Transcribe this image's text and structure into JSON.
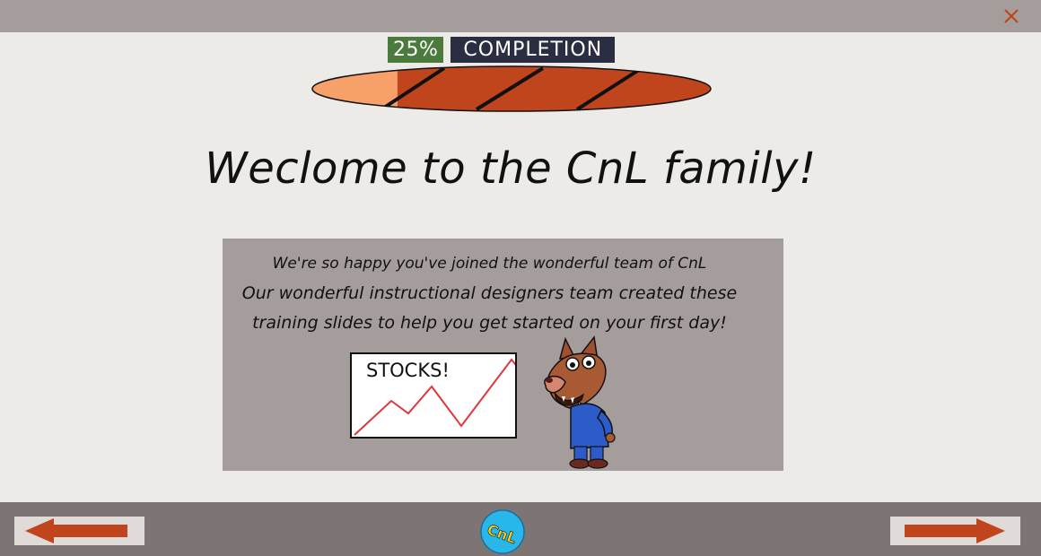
{
  "progress": {
    "percent_label": "25%",
    "completion_label": "COMPLETION",
    "value": 0.25,
    "fill_color": "#f7a06a",
    "track_color": "#c0451c"
  },
  "header": {
    "close_icon": "close-icon"
  },
  "main": {
    "title": "Weclome to the CnL family!",
    "panel": {
      "line1": "We're so happy you've joined the wonderful team of CnL",
      "line2": "Our wonderful instructional designers team created these",
      "line3": "training slides to help you get started on your first day!",
      "board_label": "STOCKS!"
    }
  },
  "footer": {
    "prev_icon": "arrow-left-icon",
    "next_icon": "arrow-right-icon",
    "logo_text": "CnL"
  },
  "colors": {
    "accent": "#c0451c",
    "topbar": "#a59d9b",
    "bottombar": "#7c7574",
    "background": "#ecebe8"
  }
}
